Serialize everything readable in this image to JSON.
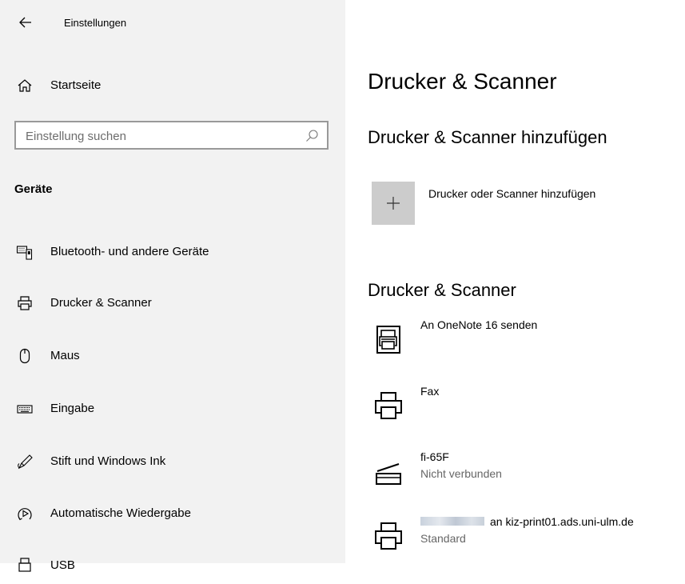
{
  "window": {
    "title": "Einstellungen"
  },
  "sidebar": {
    "home_label": "Startseite",
    "search_placeholder": "Einstellung suchen",
    "group_label": "Geräte",
    "items": [
      {
        "label": "Bluetooth- und andere Geräte",
        "icon": "bluetooth-devices-icon"
      },
      {
        "label": "Drucker & Scanner",
        "icon": "printer-icon"
      },
      {
        "label": "Maus",
        "icon": "mouse-icon"
      },
      {
        "label": "Eingabe",
        "icon": "keyboard-icon"
      },
      {
        "label": "Stift und Windows Ink",
        "icon": "pen-icon"
      },
      {
        "label": "Automatische Wiedergabe",
        "icon": "autoplay-icon"
      },
      {
        "label": "USB",
        "icon": "usb-icon"
      }
    ]
  },
  "main": {
    "title": "Drucker & Scanner",
    "add_section_title": "Drucker & Scanner hinzufügen",
    "add_button_label": "Drucker oder Scanner hinzufügen",
    "list_section_title": "Drucker & Scanner",
    "devices": [
      {
        "name": "An OneNote 16 senden",
        "status": "",
        "icon": "onenote-printer-icon"
      },
      {
        "name": "Fax",
        "status": "",
        "icon": "printer-icon"
      },
      {
        "name": "fi-65F",
        "status": "Nicht verbunden",
        "icon": "scanner-icon"
      },
      {
        "name": "an kiz-print01.ads.uni-ulm.de",
        "status": "Standard",
        "icon": "printer-icon"
      }
    ]
  },
  "colors": {
    "sidebar_bg": "#f2f2f2",
    "add_button_bg": "#cccccc",
    "status_text": "#666666"
  }
}
